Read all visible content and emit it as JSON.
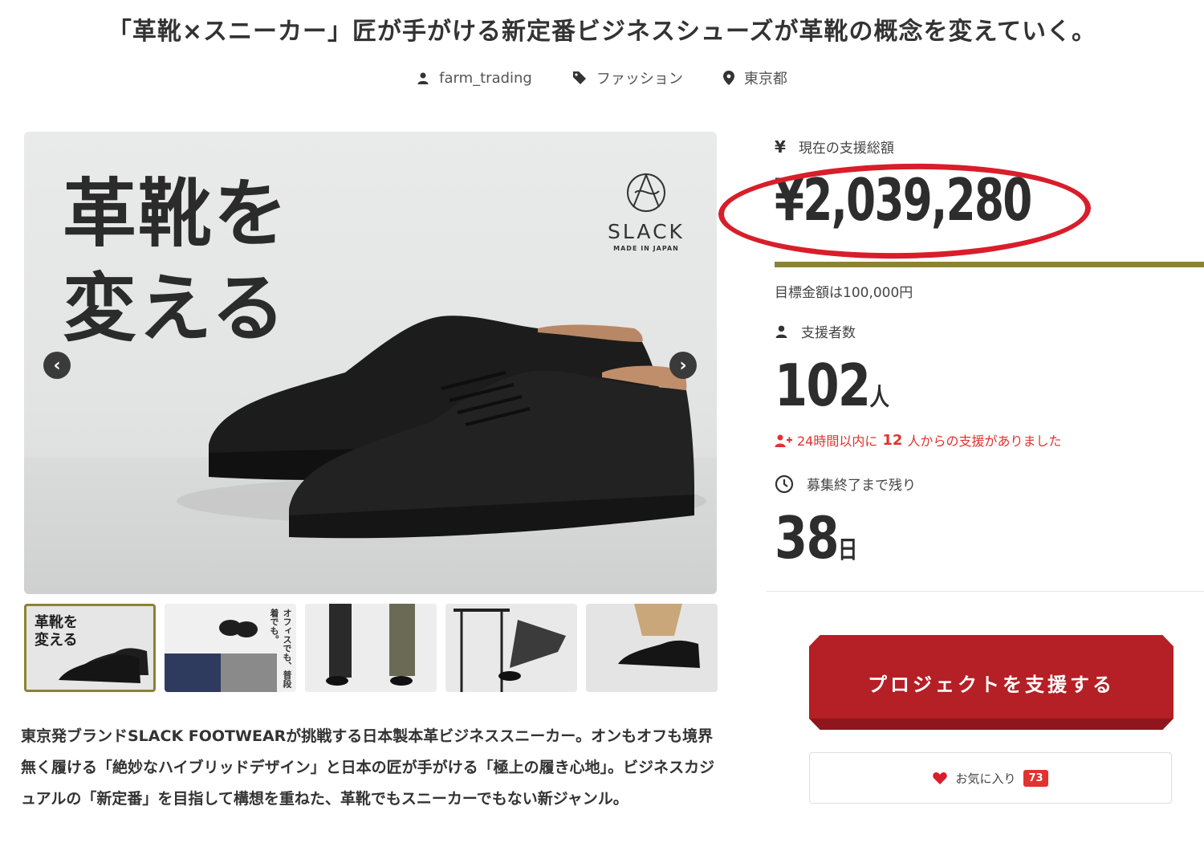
{
  "title": "「革靴×スニーカー」匠が手がける新定番ビジネスシューズが革靴の概念を変えていく。",
  "meta": {
    "owner": "farm_trading",
    "category": "ファッション",
    "location": "東京都"
  },
  "hero": {
    "headline_line1": "革靴を",
    "headline_line2": "変える",
    "logo_brand": "SLACK",
    "logo_sub": "MADE IN JAPAN",
    "prev_arrow": "‹",
    "next_arrow": "›"
  },
  "thumbnails": [
    {
      "label": "革靴を変える",
      "active": true
    },
    {
      "label": "オフィスでも、普段着でも。",
      "active": false
    },
    {
      "label": "",
      "active": false
    },
    {
      "label": "",
      "active": false
    },
    {
      "label": "",
      "active": false
    }
  ],
  "thumb1_line1": "革靴を",
  "thumb1_line2": "変える",
  "thumb2_text": "オフィスでも、普段着でも。",
  "description": "東京発ブランドSLACK FOOTWEARが挑戦する日本製本革ビジネススニーカー。オンもオフも境界無く履ける「絶妙なハイブリッドデザイン」と日本の匠が手がける「極上の履き心地」。ビジネスカジュアルの「新定番」を目指して構想を重ねた、革靴でもスニーカーでもない新ジャンル。",
  "funding": {
    "currency_icon": "¥",
    "total_label": "現在の支援総額",
    "total_amount": "¥2,039,280",
    "progress_fraction": 1.0,
    "goal_text": "目標金額は100,000円",
    "backers_label": "支援者数",
    "backers_count": "102",
    "backers_unit": "人",
    "recent_prefix": "24時間以内に",
    "recent_count": "12",
    "recent_suffix": "人からの支援がありました",
    "remaining_label": "募集終了まで残り",
    "remaining_days": "38",
    "remaining_unit": "日"
  },
  "actions": {
    "support_label": "プロジェクトを支援する",
    "favorite_label": "お気に入り",
    "favorite_count": "73"
  },
  "colors": {
    "accent": "#8b8332",
    "button": "#b51f26",
    "highlight": "#d81e2a",
    "alert": "#e0322f"
  }
}
